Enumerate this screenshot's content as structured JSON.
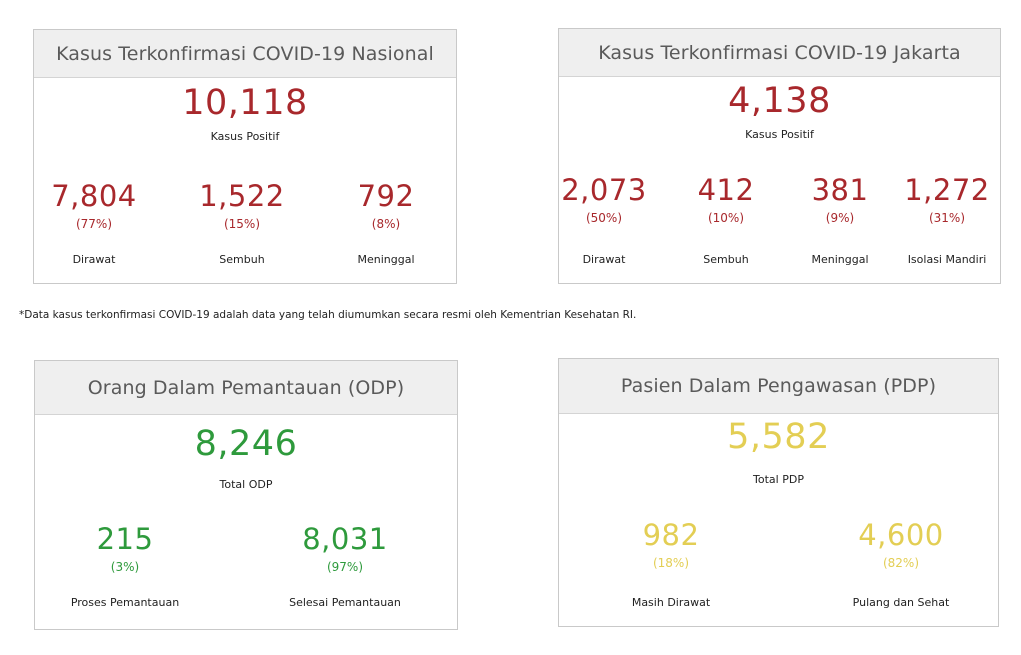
{
  "colors": {
    "positive": "#a8282c",
    "odp": "#2e9a3c",
    "pdp": "#e3ce54"
  },
  "nasional": {
    "title": "Kasus Terkonfirmasi COVID-19 Nasional",
    "total": "10,118",
    "total_label": "Kasus Positif",
    "stats": [
      {
        "value": "7,804",
        "pct": "(77%)",
        "label": "Dirawat"
      },
      {
        "value": "1,522",
        "pct": "(15%)",
        "label": "Sembuh"
      },
      {
        "value": "792",
        "pct": "(8%)",
        "label": "Meninggal"
      }
    ]
  },
  "jakarta": {
    "title": "Kasus Terkonfirmasi COVID-19 Jakarta",
    "total": "4,138",
    "total_label": "Kasus Positif",
    "stats": [
      {
        "value": "2,073",
        "pct": "(50%)",
        "label": "Dirawat"
      },
      {
        "value": "412",
        "pct": "(10%)",
        "label": "Sembuh"
      },
      {
        "value": "381",
        "pct": "(9%)",
        "label": "Meninggal"
      },
      {
        "value": "1,272",
        "pct": "(31%)",
        "label": "Isolasi Mandiri"
      }
    ]
  },
  "note": "*Data kasus terkonfirmasi COVID-19 adalah data yang telah diumumkan secara resmi oleh Kementrian Kesehatan RI.",
  "odp": {
    "title": "Orang Dalam Pemantauan (ODP)",
    "total": "8,246",
    "total_label": "Total ODP",
    "stats": [
      {
        "value": "215",
        "pct": "(3%)",
        "label": "Proses Pemantauan"
      },
      {
        "value": "8,031",
        "pct": "(97%)",
        "label": "Selesai Pemantauan"
      }
    ]
  },
  "pdp": {
    "title": "Pasien Dalam Pengawasan (PDP)",
    "total": "5,582",
    "total_label": "Total PDP",
    "stats": [
      {
        "value": "982",
        "pct": "(18%)",
        "label": "Masih Dirawat"
      },
      {
        "value": "4,600",
        "pct": "(82%)",
        "label": "Pulang dan Sehat"
      }
    ]
  }
}
